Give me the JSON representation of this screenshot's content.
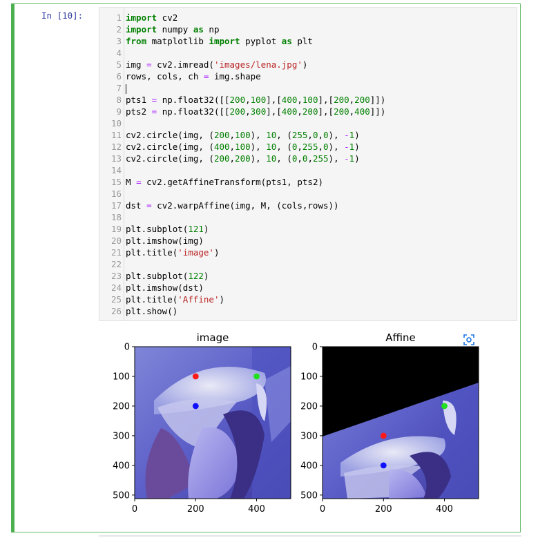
{
  "cell": {
    "prompt": "In [10]:",
    "line_numbers": [
      "1",
      "2",
      "3",
      "4",
      "5",
      "6",
      "7",
      "8",
      "9",
      "10",
      "11",
      "12",
      "13",
      "14",
      "15",
      "16",
      "17",
      "18",
      "19",
      "20",
      "21",
      "22",
      "23",
      "24",
      "25",
      "26"
    ],
    "code_lines": [
      [
        {
          "t": "import",
          "c": "kw"
        },
        {
          "t": " cv2",
          "c": ""
        }
      ],
      [
        {
          "t": "import",
          "c": "kw"
        },
        {
          "t": " numpy ",
          "c": ""
        },
        {
          "t": "as",
          "c": "kw"
        },
        {
          "t": " np",
          "c": ""
        }
      ],
      [
        {
          "t": "from",
          "c": "kw"
        },
        {
          "t": " matplotlib ",
          "c": ""
        },
        {
          "t": "import",
          "c": "kw"
        },
        {
          "t": " pyplot ",
          "c": ""
        },
        {
          "t": "as",
          "c": "kw"
        },
        {
          "t": " plt",
          "c": ""
        }
      ],
      [],
      [
        {
          "t": "img ",
          "c": ""
        },
        {
          "t": "=",
          "c": "op"
        },
        {
          "t": " cv2.imread(",
          "c": ""
        },
        {
          "t": "'images/lena.jpg'",
          "c": "str"
        },
        {
          "t": ")",
          "c": ""
        }
      ],
      [
        {
          "t": "rows, cols, ch ",
          "c": ""
        },
        {
          "t": "=",
          "c": "op"
        },
        {
          "t": " img.shape",
          "c": ""
        }
      ],
      [
        {
          "t": "",
          "c": "cursor"
        }
      ],
      [
        {
          "t": "pts1 ",
          "c": ""
        },
        {
          "t": "=",
          "c": "op"
        },
        {
          "t": " np.float32([[",
          "c": ""
        },
        {
          "t": "200",
          "c": "num"
        },
        {
          "t": ",",
          "c": ""
        },
        {
          "t": "100",
          "c": "num"
        },
        {
          "t": "],[",
          "c": ""
        },
        {
          "t": "400",
          "c": "num"
        },
        {
          "t": ",",
          "c": ""
        },
        {
          "t": "100",
          "c": "num"
        },
        {
          "t": "],[",
          "c": ""
        },
        {
          "t": "200",
          "c": "num"
        },
        {
          "t": ",",
          "c": ""
        },
        {
          "t": "200",
          "c": "num"
        },
        {
          "t": "]])",
          "c": ""
        }
      ],
      [
        {
          "t": "pts2 ",
          "c": ""
        },
        {
          "t": "=",
          "c": "op"
        },
        {
          "t": " np.float32([[",
          "c": ""
        },
        {
          "t": "200",
          "c": "num"
        },
        {
          "t": ",",
          "c": ""
        },
        {
          "t": "300",
          "c": "num"
        },
        {
          "t": "],[",
          "c": ""
        },
        {
          "t": "400",
          "c": "num"
        },
        {
          "t": ",",
          "c": ""
        },
        {
          "t": "200",
          "c": "num"
        },
        {
          "t": "],[",
          "c": ""
        },
        {
          "t": "200",
          "c": "num"
        },
        {
          "t": ",",
          "c": ""
        },
        {
          "t": "400",
          "c": "num"
        },
        {
          "t": "]])",
          "c": ""
        }
      ],
      [],
      [
        {
          "t": "cv2.circle(img, (",
          "c": ""
        },
        {
          "t": "200",
          "c": "num"
        },
        {
          "t": ",",
          "c": ""
        },
        {
          "t": "100",
          "c": "num"
        },
        {
          "t": "), ",
          "c": ""
        },
        {
          "t": "10",
          "c": "num"
        },
        {
          "t": ", (",
          "c": ""
        },
        {
          "t": "255",
          "c": "num"
        },
        {
          "t": ",",
          "c": ""
        },
        {
          "t": "0",
          "c": "num"
        },
        {
          "t": ",",
          "c": ""
        },
        {
          "t": "0",
          "c": "num"
        },
        {
          "t": "), ",
          "c": ""
        },
        {
          "t": "-",
          "c": "op"
        },
        {
          "t": "1",
          "c": "num"
        },
        {
          "t": ")",
          "c": ""
        }
      ],
      [
        {
          "t": "cv2.circle(img, (",
          "c": ""
        },
        {
          "t": "400",
          "c": "num"
        },
        {
          "t": ",",
          "c": ""
        },
        {
          "t": "100",
          "c": "num"
        },
        {
          "t": "), ",
          "c": ""
        },
        {
          "t": "10",
          "c": "num"
        },
        {
          "t": ", (",
          "c": ""
        },
        {
          "t": "0",
          "c": "num"
        },
        {
          "t": ",",
          "c": ""
        },
        {
          "t": "255",
          "c": "num"
        },
        {
          "t": ",",
          "c": ""
        },
        {
          "t": "0",
          "c": "num"
        },
        {
          "t": "), ",
          "c": ""
        },
        {
          "t": "-",
          "c": "op"
        },
        {
          "t": "1",
          "c": "num"
        },
        {
          "t": ")",
          "c": ""
        }
      ],
      [
        {
          "t": "cv2.circle(img, (",
          "c": ""
        },
        {
          "t": "200",
          "c": "num"
        },
        {
          "t": ",",
          "c": ""
        },
        {
          "t": "200",
          "c": "num"
        },
        {
          "t": "), ",
          "c": ""
        },
        {
          "t": "10",
          "c": "num"
        },
        {
          "t": ", (",
          "c": ""
        },
        {
          "t": "0",
          "c": "num"
        },
        {
          "t": ",",
          "c": ""
        },
        {
          "t": "0",
          "c": "num"
        },
        {
          "t": ",",
          "c": ""
        },
        {
          "t": "255",
          "c": "num"
        },
        {
          "t": "), ",
          "c": ""
        },
        {
          "t": "-",
          "c": "op"
        },
        {
          "t": "1",
          "c": "num"
        },
        {
          "t": ")",
          "c": ""
        }
      ],
      [],
      [
        {
          "t": "M ",
          "c": ""
        },
        {
          "t": "=",
          "c": "op"
        },
        {
          "t": " cv2.getAffineTransform(pts1, pts2)",
          "c": ""
        }
      ],
      [],
      [
        {
          "t": "dst ",
          "c": ""
        },
        {
          "t": "=",
          "c": "op"
        },
        {
          "t": " cv2.warpAffine(img, M, (cols,rows))",
          "c": ""
        }
      ],
      [],
      [
        {
          "t": "plt.subplot(",
          "c": ""
        },
        {
          "t": "121",
          "c": "num"
        },
        {
          "t": ")",
          "c": ""
        }
      ],
      [
        {
          "t": "plt.imshow(img)",
          "c": ""
        }
      ],
      [
        {
          "t": "plt.title(",
          "c": ""
        },
        {
          "t": "'image'",
          "c": "str"
        },
        {
          "t": ")",
          "c": ""
        }
      ],
      [],
      [
        {
          "t": "plt.subplot(",
          "c": ""
        },
        {
          "t": "122",
          "c": "num"
        },
        {
          "t": ")",
          "c": ""
        }
      ],
      [
        {
          "t": "plt.imshow(dst)",
          "c": ""
        }
      ],
      [
        {
          "t": "plt.title(",
          "c": ""
        },
        {
          "t": "'Affine'",
          "c": "str"
        },
        {
          "t": ")",
          "c": ""
        }
      ],
      [
        {
          "t": "plt.show()",
          "c": ""
        }
      ]
    ]
  },
  "output": {
    "figure_icon": "image-search-icon",
    "axis_ticks": [
      "0",
      "100",
      "200",
      "300",
      "400",
      "500"
    ],
    "x_ticks": [
      "0",
      "200",
      "400"
    ],
    "colors": {
      "tint": "#6b6fd6",
      "red": "#ff1a1a",
      "green": "#20e020",
      "blue": "#1010ff"
    }
  },
  "chart_data": [
    {
      "type": "image",
      "title": "image",
      "xlim": [
        0,
        512
      ],
      "ylim": [
        512,
        0
      ],
      "xticks": [
        0,
        200,
        400
      ],
      "yticks": [
        0,
        100,
        200,
        300,
        400,
        500
      ],
      "points": [
        {
          "x": 200,
          "y": 100,
          "color": "red"
        },
        {
          "x": 400,
          "y": 100,
          "color": "green"
        },
        {
          "x": 200,
          "y": 200,
          "color": "blue"
        }
      ]
    },
    {
      "type": "image",
      "title": "Affine",
      "xlim": [
        0,
        512
      ],
      "ylim": [
        512,
        0
      ],
      "xticks": [
        0,
        200,
        400
      ],
      "yticks": [
        0,
        100,
        200,
        300,
        400,
        500
      ],
      "points": [
        {
          "x": 200,
          "y": 300,
          "color": "red"
        },
        {
          "x": 400,
          "y": 200,
          "color": "green"
        },
        {
          "x": 200,
          "y": 400,
          "color": "blue"
        }
      ]
    }
  ]
}
